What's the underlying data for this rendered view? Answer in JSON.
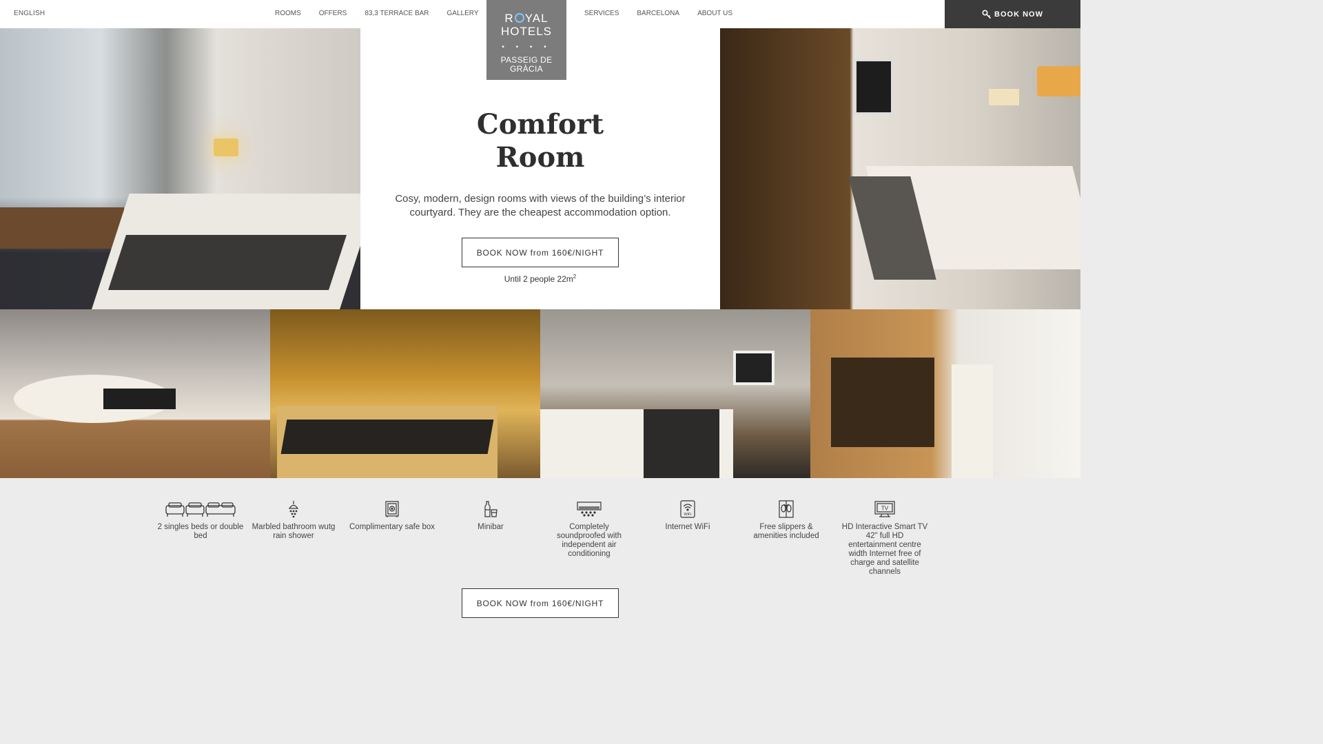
{
  "header": {
    "language": "ENGLISH",
    "nav_left": [
      "ROOMS",
      "OFFERS",
      "83,3 TERRACE BAR",
      "GALLERY"
    ],
    "nav_right": [
      "SERVICES",
      "BARCELONA",
      "ABOUT US"
    ],
    "book_label": "BOOK NOW",
    "logo": {
      "brand_line1_pre": "R",
      "brand_line1_post": "YAL",
      "brand_line2": "HOTELS",
      "stars": "• • • •",
      "location_line1": "PASSEIG DE",
      "location_line2": "GRÀCIA"
    }
  },
  "room": {
    "title_line1": "Comfort",
    "title_line2": "Room",
    "description": "Cosy, modern, design rooms with views of the building’s interior courtyard. They are the cheapest accommodation option.",
    "book_label": "BOOK NOW from 160€/NIGHT",
    "capacity": "Until 2 people 22m",
    "capacity_sup": "2"
  },
  "amenities": [
    {
      "icon": "beds-icon",
      "label": "2 singles beds or double bed"
    },
    {
      "icon": "shower-icon",
      "label": "Marbled bathroom wutg rain shower"
    },
    {
      "icon": "safe-icon",
      "label": "Complimentary safe box"
    },
    {
      "icon": "minibar-icon",
      "label": "Minibar"
    },
    {
      "icon": "air-conditioning-icon",
      "label": "Completely soundproofed with independent air conditioning"
    },
    {
      "icon": "wifi-icon",
      "label": "Internet WiFi",
      "icon_text": "WiFi"
    },
    {
      "icon": "slippers-icon",
      "label": "Free slippers & amenities included"
    },
    {
      "icon": "tv-icon",
      "label": "HD Interactive Smart TV 42\" full HD entertainment centre width Internet free of charge and satellite channels",
      "icon_text": "TV"
    }
  ],
  "bottom": {
    "book_label": "BOOK NOW from 160€/NIGHT"
  },
  "colors": {
    "topbar_bg": "#ffffff",
    "book_button_bg": "#3b3b3b",
    "logo_bg": "#7c7c7c",
    "logo_accent": "#7fc4ff",
    "page_bg": "#ececec"
  }
}
